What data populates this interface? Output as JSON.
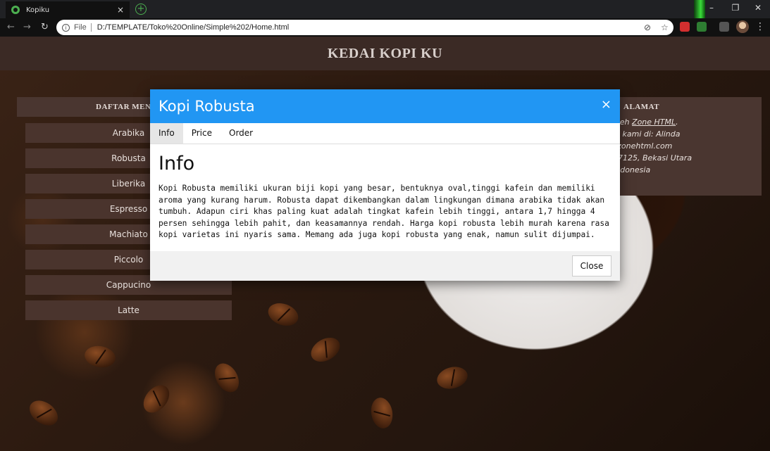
{
  "browser": {
    "tab_title": "Kopiku",
    "tab_close": "×",
    "new_tab": "+",
    "window_minimize": "–",
    "window_restore": "❐",
    "window_close": "✕",
    "back": "←",
    "forward": "→",
    "reload": "↻",
    "scheme": "File",
    "url": "D:/TEMPLATE/Toko%20Online/Simple%202/Home.html",
    "star": "☆",
    "menu": "⋮",
    "accent": "#4caf50"
  },
  "site": {
    "title": "KEDAI KOPI KU",
    "header_color": "#3b2a25"
  },
  "left_menu": {
    "title": "DAFTAR MEN",
    "items": [
      "Arabika",
      "Robusta",
      "Liberika",
      "Espresso",
      "Machiato",
      "Piccolo",
      "Cappucino",
      "Latte"
    ]
  },
  "right_panel": {
    "title": "ALAMAT",
    "line1_prefix": "oleh ",
    "line1_link": "Zone HTML",
    "line1_suffix": ".",
    "line2": "gi kami di: Alinda",
    "line3": "ilzonehtml.com",
    "line4": "17125, Bekasi Utara",
    "line5": "Indonesia"
  },
  "modal": {
    "title": "Kopi Robusta",
    "close_icon": "×",
    "header_color": "#2196f3",
    "tabs": [
      "Info",
      "Price",
      "Order"
    ],
    "active_tab": "Info",
    "heading": "Info",
    "paragraph": "Kopi Robusta memiliki ukuran biji kopi yang besar, bentuknya oval,tinggi kafein dan memiliki aroma yang kurang harum. Robusta dapat dikembangkan dalam lingkungan dimana arabika tidak akan tumbuh. Adapun ciri khas paling kuat adalah tingkat kafein lebih tinggi, antara 1,7 hingga 4 persen sehingga lebih pahit, dan keasamannya rendah. Harga kopi robusta lebih murah karena rasa kopi varietas ini nyaris sama. Memang ada juga kopi robusta yang enak, namun sulit dijumpai.",
    "close_button": "Close"
  }
}
